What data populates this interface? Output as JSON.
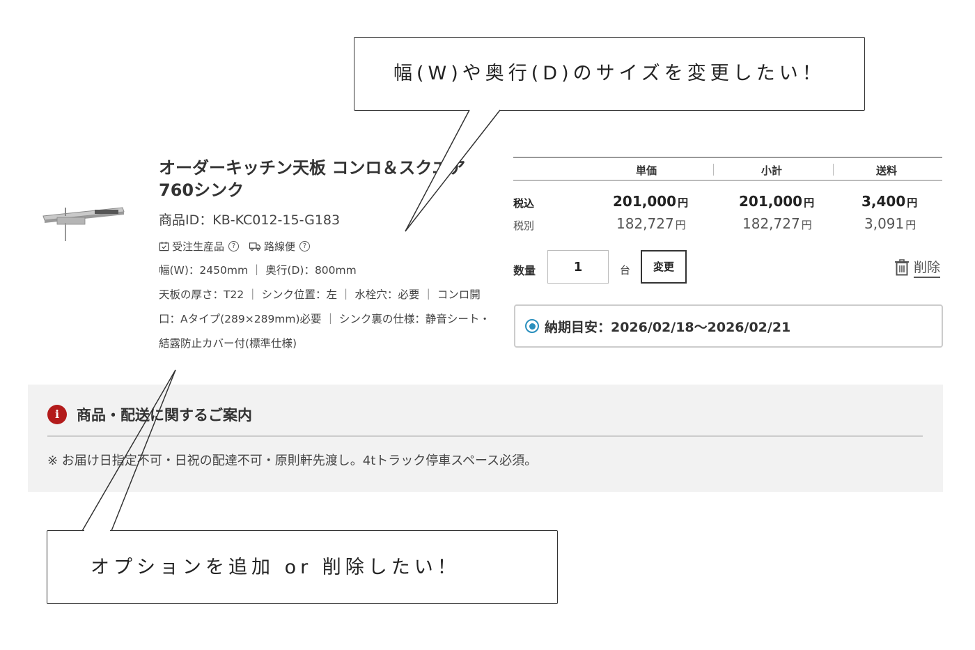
{
  "product": {
    "title": "オーダーキッチン天板 コンロ＆スクエア760シンク",
    "id_text": "商品ID：KB-KC012-15-G183",
    "tag_order": "受注生産品",
    "tag_shipping": "路線便",
    "help_mark": "?",
    "spec_size": "幅(W)：2450mm ｜ 奥行(D)：800mm",
    "spec_options": "天板の厚さ：T22 ｜ シンク位置：左 ｜ 水栓穴：必要 ｜ コンロ開口：Aタイプ(289×289mm)必要 ｜ シンク裏の仕様：静音シート・結露防止カバー付(標準仕様)"
  },
  "price_table": {
    "headers": [
      "単価",
      "小計",
      "送料"
    ],
    "rows": [
      {
        "label": "税込",
        "values": [
          "201,000",
          "201,000",
          "3,400"
        ],
        "unit": "円"
      },
      {
        "label": "税別",
        "values": [
          "182,727",
          "182,727",
          "3,091"
        ],
        "unit": "円"
      }
    ]
  },
  "quantity": {
    "label": "数量",
    "value": "1",
    "unit": "台",
    "change_button": "変更",
    "delete_label": "削除"
  },
  "delivery": {
    "text": "納期目安：2026/02/18〜2026/02/21"
  },
  "notice": {
    "icon_text": "i",
    "title": "商品・配送に関するご案内",
    "text": "※ お届け日指定不可・日祝の配達不可・原則軒先渡し。4tトラック停車スペース必須。"
  },
  "callouts": {
    "top": "幅(W)や奥行(D)のサイズを変更したい！",
    "bottom": "オプションを追加 or 削除したい！"
  },
  "colors": {
    "accent_blue": "#2a8fbd",
    "notice_red": "#b31b1b",
    "notice_bg": "#f2f2f2"
  }
}
